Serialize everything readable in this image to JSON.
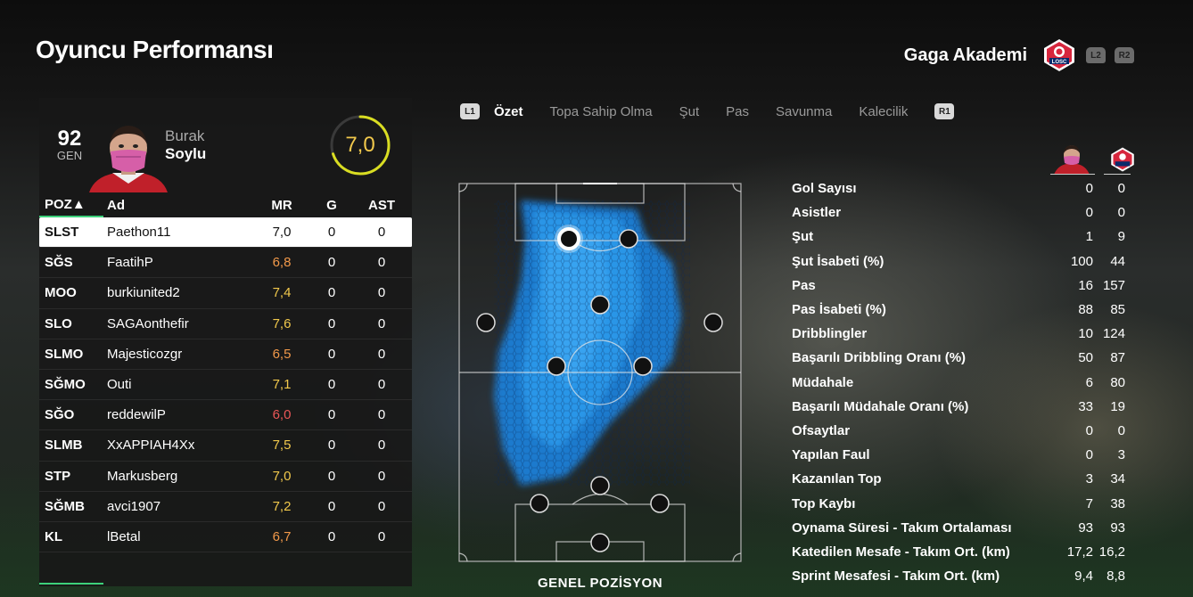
{
  "header": {
    "title": "Oyuncu Performansı",
    "club_name": "Gaga Akademi",
    "club_badge_text": "LOSC",
    "triggers": [
      "L2",
      "R2"
    ]
  },
  "player": {
    "ovr": "92",
    "ovr_label": "GEN",
    "first_name": "Burak",
    "last_name": "Soylu",
    "rating": "7,0",
    "rating_fraction": 0.7
  },
  "table": {
    "headers": [
      "POZ▲",
      "Ad",
      "MR",
      "G",
      "AST"
    ],
    "rows": [
      {
        "poz": "SLST",
        "ad": "Paethon11",
        "mr": "7,0",
        "g": "0",
        "ast": "0",
        "mr_color": "#111111"
      },
      {
        "poz": "SĞS",
        "ad": "FaatihP",
        "mr": "6,8",
        "g": "0",
        "ast": "0",
        "mr_color": "#f2994a"
      },
      {
        "poz": "MOO",
        "ad": "burkiunited2",
        "mr": "7,4",
        "g": "0",
        "ast": "0",
        "mr_color": "#f2c94c"
      },
      {
        "poz": "SLO",
        "ad": "SAGAonthefir",
        "mr": "7,6",
        "g": "0",
        "ast": "0",
        "mr_color": "#f2c94c"
      },
      {
        "poz": "SLMO",
        "ad": "Majesticozgr",
        "mr": "6,5",
        "g": "0",
        "ast": "0",
        "mr_color": "#f2994a"
      },
      {
        "poz": "SĞMO",
        "ad": "Outi",
        "mr": "7,1",
        "g": "0",
        "ast": "0",
        "mr_color": "#f2c94c"
      },
      {
        "poz": "SĞO",
        "ad": "reddewilP",
        "mr": "6,0",
        "g": "0",
        "ast": "0",
        "mr_color": "#eb5757"
      },
      {
        "poz": "SLMB",
        "ad": "XxAPPIAH4Xx",
        "mr": "7,5",
        "g": "0",
        "ast": "0",
        "mr_color": "#f2c94c"
      },
      {
        "poz": "STP",
        "ad": "Markusberg",
        "mr": "7,0",
        "g": "0",
        "ast": "0",
        "mr_color": "#f2c94c"
      },
      {
        "poz": "SĞMB",
        "ad": "avci1907",
        "mr": "7,2",
        "g": "0",
        "ast": "0",
        "mr_color": "#f2c94c"
      },
      {
        "poz": "KL",
        "ad": "lBetal",
        "mr": "6,7",
        "g": "0",
        "ast": "0",
        "mr_color": "#f2994a"
      }
    ]
  },
  "tabs": {
    "left_button": "L1",
    "right_button": "R1",
    "items": [
      "Özet",
      "Topa Sahip Olma",
      "Şut",
      "Pas",
      "Savunma",
      "Kalecilik"
    ],
    "active": "Özet"
  },
  "pitch": {
    "label": "GENEL POZİSYON",
    "heat_color": "#1e8fe6"
  },
  "stats": [
    {
      "label": "Gol Sayısı",
      "v1": "0",
      "v2": "0"
    },
    {
      "label": "Asistler",
      "v1": "0",
      "v2": "0"
    },
    {
      "label": "Şut",
      "v1": "1",
      "v2": "9"
    },
    {
      "label": "Şut İsabeti (%)",
      "v1": "100",
      "v2": "44"
    },
    {
      "label": "Pas",
      "v1": "16",
      "v2": "157"
    },
    {
      "label": "Pas İsabeti (%)",
      "v1": "88",
      "v2": "85"
    },
    {
      "label": "Dribblingler",
      "v1": "10",
      "v2": "124"
    },
    {
      "label": "Başarılı Dribbling Oranı (%)",
      "v1": "50",
      "v2": "87"
    },
    {
      "label": "Müdahale",
      "v1": "6",
      "v2": "80"
    },
    {
      "label": "Başarılı Müdahale Oranı (%)",
      "v1": "33",
      "v2": "19"
    },
    {
      "label": "Ofsaytlar",
      "v1": "0",
      "v2": "0"
    },
    {
      "label": "Yapılan Faul",
      "v1": "0",
      "v2": "3"
    },
    {
      "label": "Kazanılan Top",
      "v1": "3",
      "v2": "34"
    },
    {
      "label": "Top Kaybı",
      "v1": "7",
      "v2": "38"
    },
    {
      "label": "Oynama Süresi - Takım Ortalaması",
      "v1": "93",
      "v2": "93"
    },
    {
      "label": "Katedilen Mesafe - Takım Ort. (km)",
      "v1": "17,2",
      "v2": "16,2"
    },
    {
      "label": "Sprint Mesafesi - Takım Ort. (km)",
      "v1": "9,4",
      "v2": "8,8"
    }
  ]
}
